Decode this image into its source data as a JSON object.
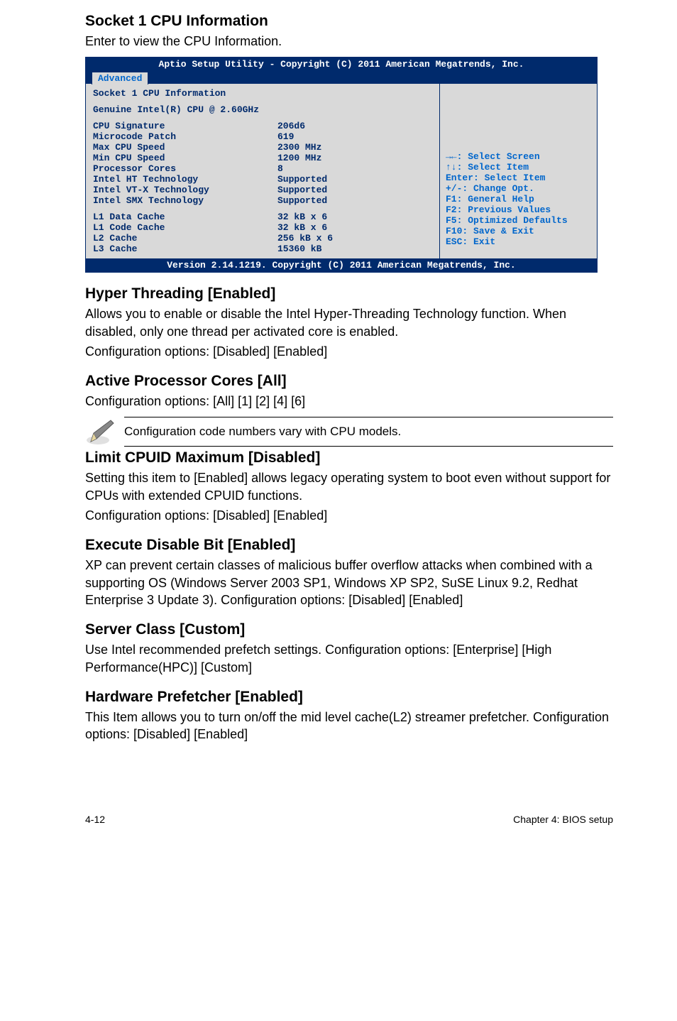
{
  "s1": {
    "title": "Socket 1 CPU Information",
    "intro": "Enter to view the CPU Information."
  },
  "bios": {
    "title_line": "Aptio Setup Utility - Copyright (C) 2011 American Megatrends, Inc.",
    "tab": "Advanced",
    "header1": "Socket 1 CPU Information",
    "header2": "Genuine Intel(R) CPU @ 2.60GHz",
    "rows": [
      {
        "label": "CPU Signature",
        "val": "206d6"
      },
      {
        "label": "Microcode Patch",
        "val": "619"
      },
      {
        "label": "Max CPU Speed",
        "val": "2300 MHz"
      },
      {
        "label": "Min CPU Speed",
        "val": "1200 MHz"
      },
      {
        "label": "Processor Cores",
        "val": "8"
      },
      {
        "label": "Intel HT Technology",
        "val": "Supported"
      },
      {
        "label": "Intel VT-X Technology",
        "val": "Supported"
      },
      {
        "label": "Intel SMX Technology",
        "val": "Supported"
      }
    ],
    "cache_rows": [
      {
        "label": "L1 Data Cache",
        "val": "32 kB x 6"
      },
      {
        "label": "L1 Code Cache",
        "val": "32 kB x 6"
      },
      {
        "label": "L2 Cache",
        "val": "256 kB x 6"
      },
      {
        "label": "L3 Cache",
        "val": "15360 kB"
      }
    ],
    "help": [
      "→←: Select Screen",
      "↑↓:  Select Item",
      "Enter: Select Item",
      "+/-: Change Opt.",
      "F1: General Help",
      "F2: Previous Values",
      "F5: Optimized Defaults",
      "F10: Save & Exit",
      "ESC: Exit"
    ],
    "footer": "Version 2.14.1219. Copyright (C) 2011 American Megatrends, Inc."
  },
  "s2": {
    "title": "Hyper Threading [Enabled]",
    "p1": "Allows you to enable or disable the Intel Hyper-Threading Technology function. When disabled, only one thread per activated core is enabled.",
    "p2": "Configuration options: [Disabled] [Enabled]"
  },
  "s3": {
    "title": "Active Processor Cores [All]",
    "p1": "Configuration options: [All] [1] [2] [4] [6]",
    "note": "Configuration code numbers vary with CPU models."
  },
  "s4": {
    "title": "Limit CPUID Maximum [Disabled]",
    "p1": "Setting this item to [Enabled] allows legacy operating system to boot even without support for CPUs with extended CPUID functions.",
    "p2": "Configuration options: [Disabled] [Enabled]"
  },
  "s5": {
    "title": "Execute Disable Bit [Enabled]",
    "p1": "XP can prevent certain classes of malicious buffer overflow attacks when combined with a supporting OS (Windows Server 2003 SP1, Windows XP SP2, SuSE Linux 9.2, Redhat Enterprise 3 Update 3). Configuration options: [Disabled] [Enabled]"
  },
  "s6": {
    "title": "Server Class [Custom]",
    "p1": "Use Intel recommended prefetch settings. Configuration options: [Enterprise] [High Performance(HPC)] [Custom]"
  },
  "s7": {
    "title": "Hardware Prefetcher [Enabled]",
    "p1": "This Item allows you to turn on/off the mid level cache(L2) streamer prefetcher. Configuration options: [Disabled] [Enabled]"
  },
  "footer": {
    "left": "4-12",
    "right": "Chapter 4: BIOS setup"
  }
}
